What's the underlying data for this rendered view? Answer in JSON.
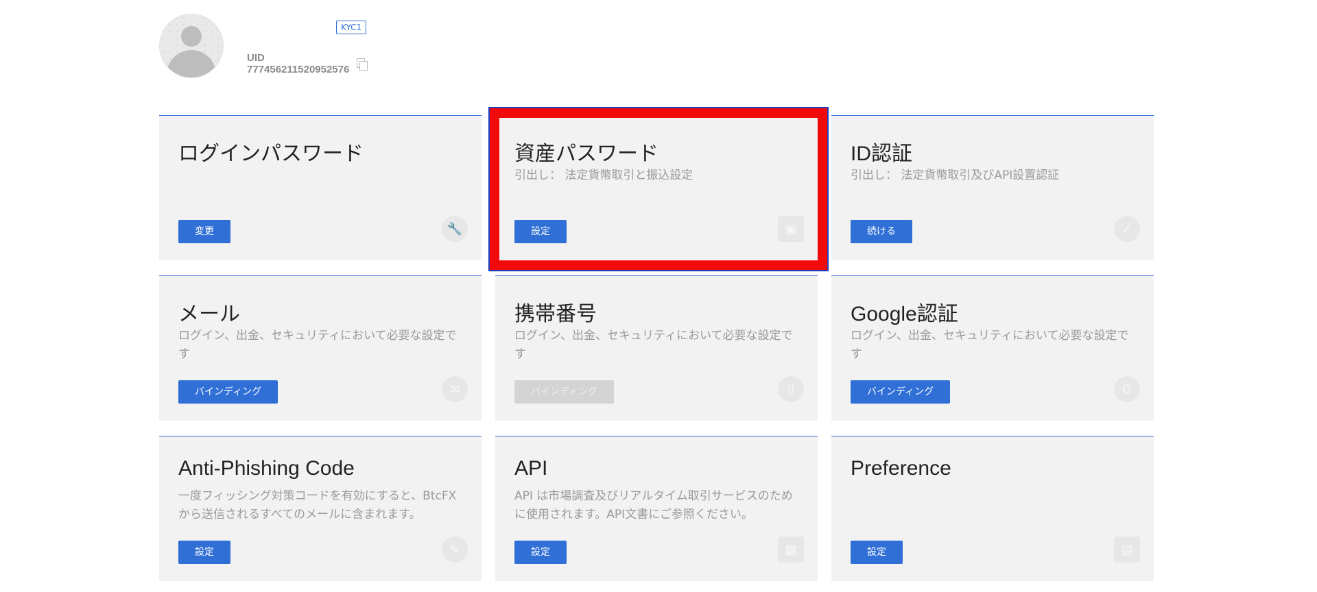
{
  "profile": {
    "kyc_badge": "KYC1",
    "uid": "UID 777456211520952576"
  },
  "cards": [
    {
      "title": "ログインパスワード",
      "desc": "",
      "button": "変更",
      "button_state": "active",
      "icon": "wrench-icon"
    },
    {
      "title": "資産パスワード",
      "desc": "引出し： 法定貨幣取引と振込設定",
      "button": "設定",
      "button_state": "active",
      "icon": "safe-icon"
    },
    {
      "title": "ID認証",
      "desc": "引出し： 法定貨幣取引及びAPI設置認証",
      "button": "続ける",
      "button_state": "active",
      "icon": "shield-check-icon"
    },
    {
      "title": "メール",
      "desc": "ログイン、出金、セキュリティにおいて必要な設定です",
      "button": "バインディング",
      "button_state": "active",
      "icon": "envelope-icon"
    },
    {
      "title": "携帯番号",
      "desc": "ログイン、出金、セキュリティにおいて必要な設定です",
      "button": "バインディング",
      "button_state": "disabled",
      "icon": "phone-icon"
    },
    {
      "title": "Google認証",
      "desc": "ログイン、出金、セキュリティにおいて必要な設定です",
      "button": "バインディング",
      "button_state": "active",
      "icon": "google-icon"
    },
    {
      "title": "Anti-Phishing Code",
      "desc": "一度フィッシング対策コードを有効にすると、BtcFXから送信されるすべてのメールに含まれます。",
      "button": "設定",
      "button_state": "active",
      "icon": "anti-phishing-icon"
    },
    {
      "title": "API",
      "desc": "API は市場調査及びリアルタイム取引サービスのために使用されます。API文書にご参照ください。",
      "button": "設定",
      "button_state": "active",
      "icon": "chip-icon"
    },
    {
      "title": "Preference",
      "desc": "",
      "button": "設定",
      "button_state": "active",
      "icon": "preference-icon"
    }
  ],
  "highlight_color": "#f00a0a",
  "accent_color": "#2f6fd6"
}
